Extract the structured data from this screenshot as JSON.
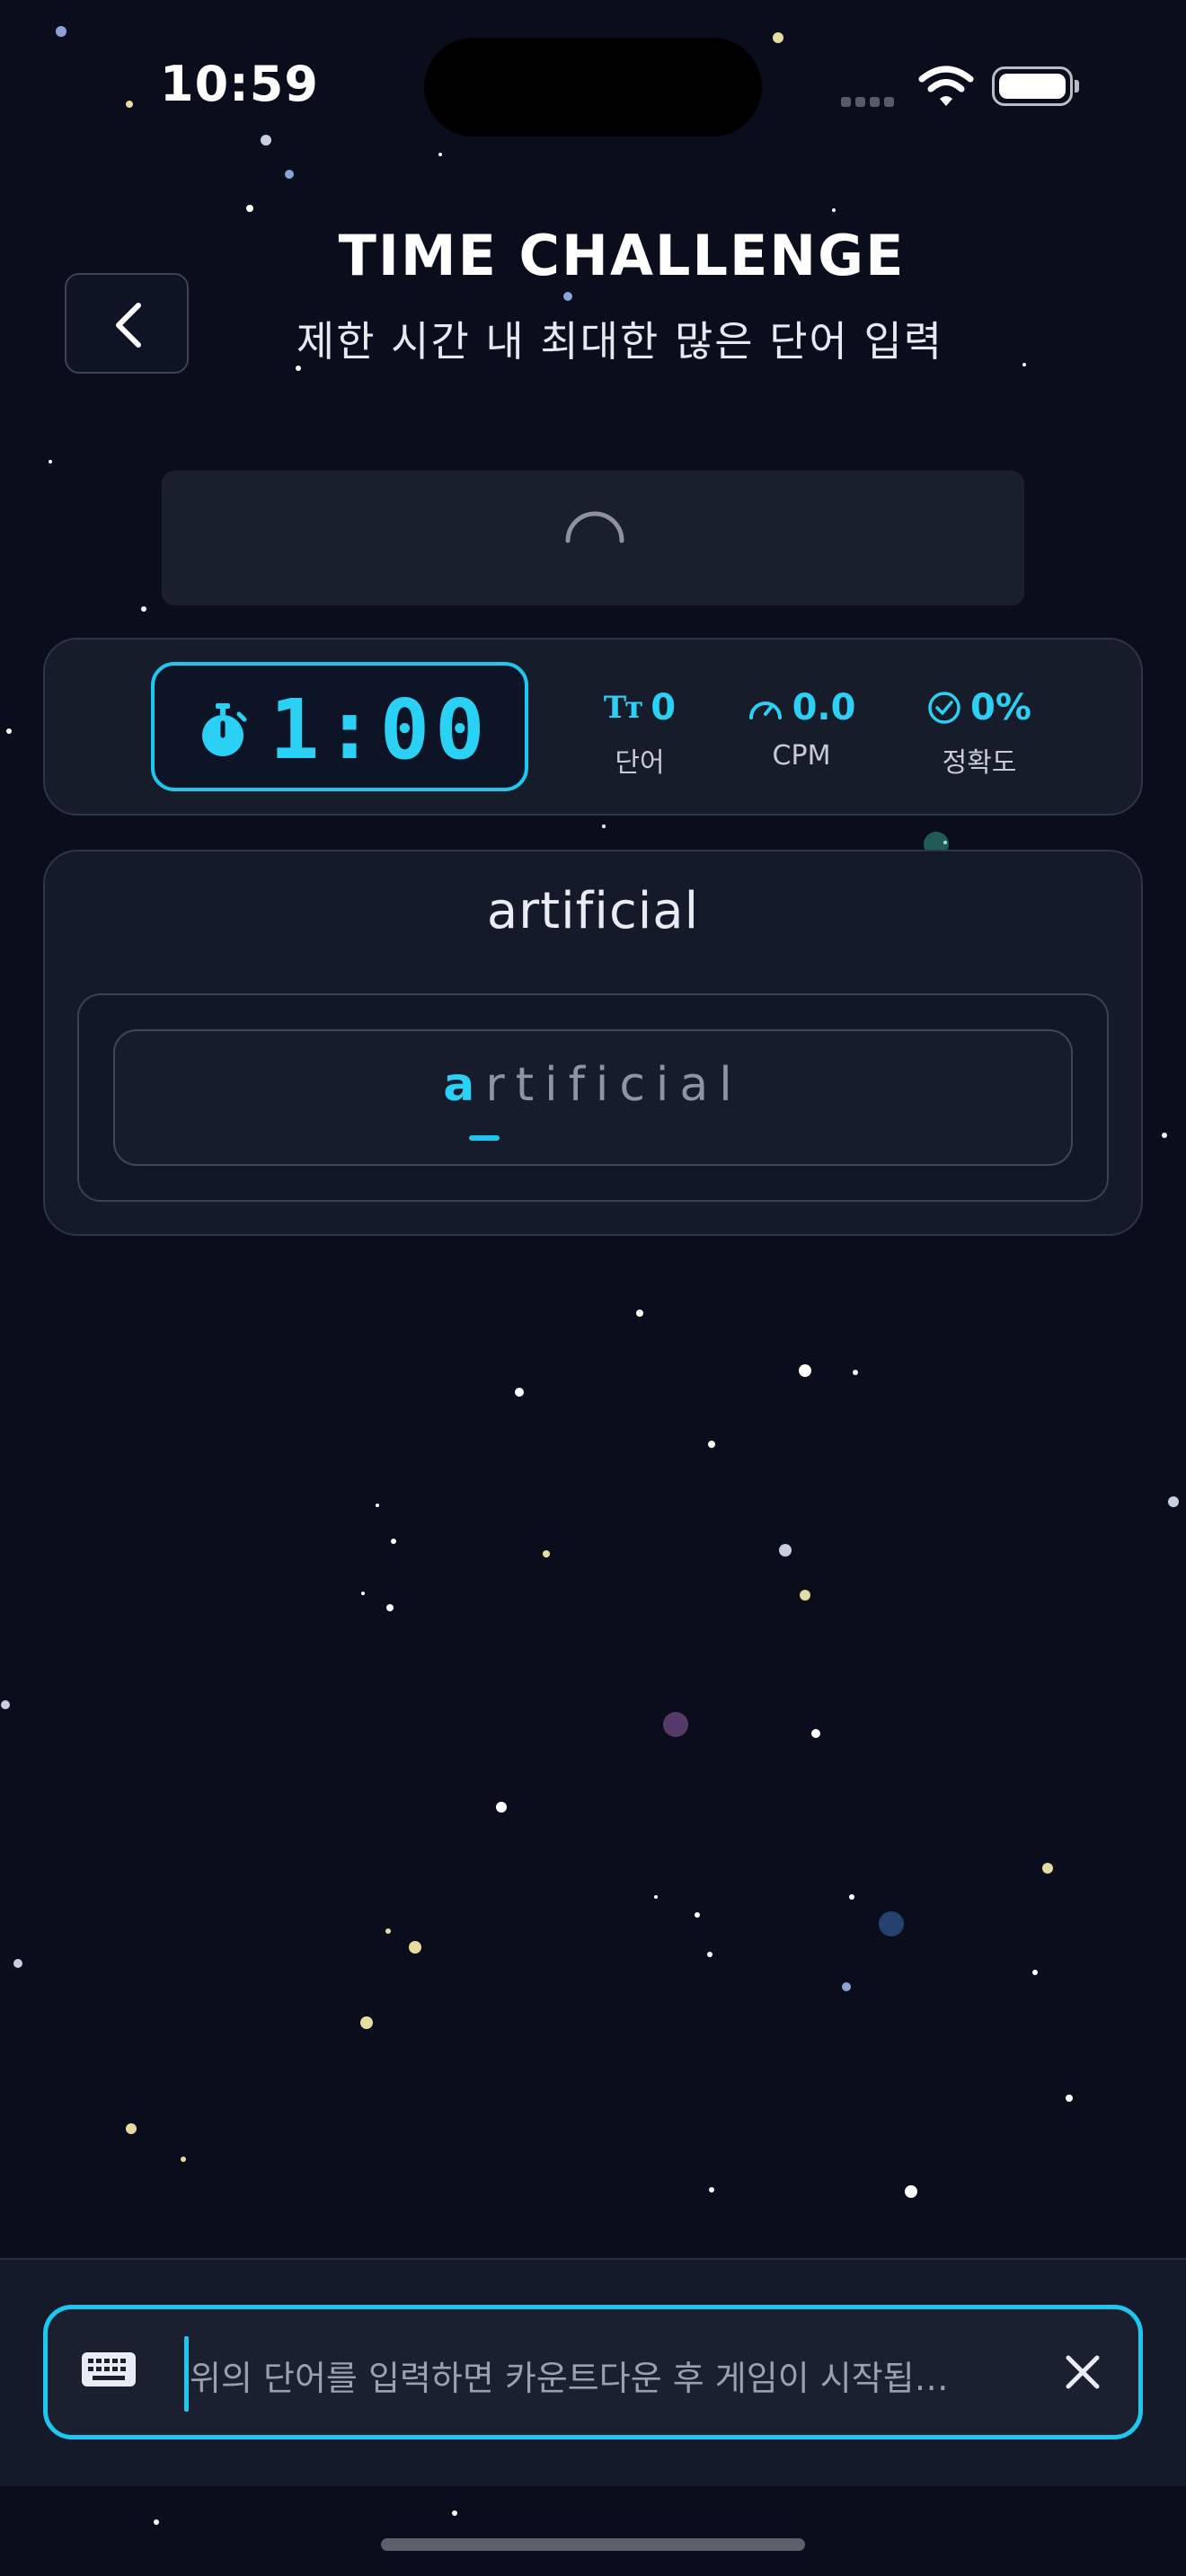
{
  "status_bar": {
    "time": "10:59",
    "icons": [
      "signal-icon",
      "wifi-icon",
      "battery-icon"
    ]
  },
  "header": {
    "back_icon": "chevron-left-icon",
    "title": "TIME CHALLENGE",
    "subtitle": "제한 시간 내 최대한 많은 단어 입력"
  },
  "loading": {
    "icon": "loading-spinner-icon"
  },
  "stats": {
    "timer": {
      "value": "1:00",
      "icon": "stopwatch-icon"
    },
    "words": {
      "value": "0",
      "label": "단어",
      "icon": "text-size-icon"
    },
    "cpm": {
      "value": "0.0",
      "label": "CPM",
      "icon": "speedometer-icon"
    },
    "accuracy": {
      "value": "0%",
      "label": "정확도",
      "icon": "check-circle-icon"
    }
  },
  "challenge": {
    "target_word": "artificial",
    "typed_current_letter": "a",
    "typed_remaining": "rtificial"
  },
  "bottom_input": {
    "keyboard_icon": "keyboard-icon",
    "placeholder": "위의 단어를 입력하면 카운트다운 후 게임이 시작됩…",
    "clear_icon": "close-icon"
  },
  "colors": {
    "background": "#0a0e1c",
    "accent": "#1fc7ee",
    "card": "#171c2b",
    "text": "#e8ecf3",
    "muted": "#8d94a2"
  }
}
